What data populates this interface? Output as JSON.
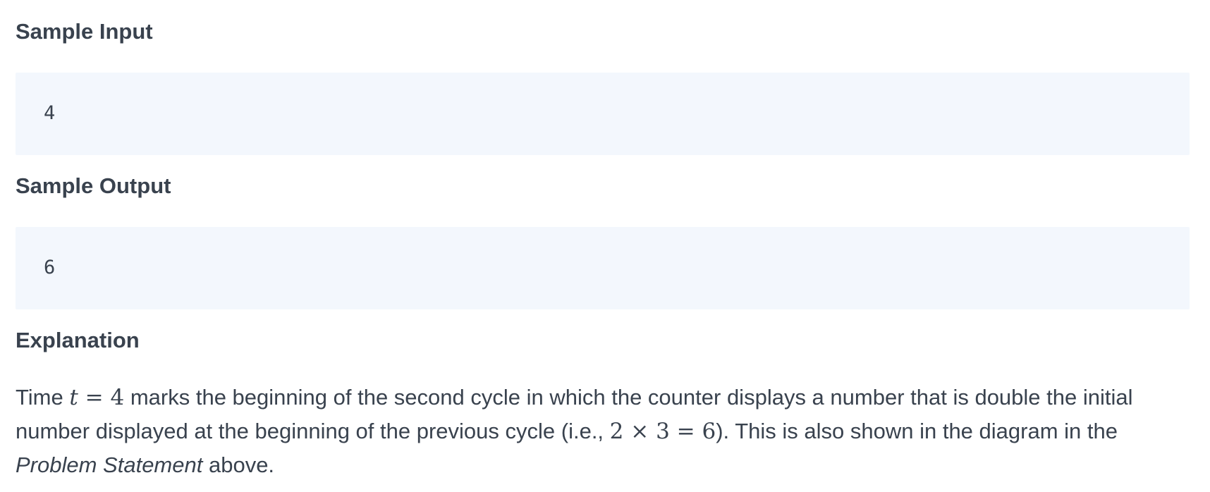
{
  "sample_input": {
    "heading": "Sample Input",
    "value": "4"
  },
  "sample_output": {
    "heading": "Sample Output",
    "value": "6"
  },
  "explanation": {
    "heading": "Explanation",
    "text_1": "Time ",
    "math_1_var": "t",
    "math_1_rest": " = 4",
    "text_2": " marks the beginning of the second cycle in which the counter displays a number that is double the initial number displayed at the beginning of the previous cycle (i.e., ",
    "math_2": "2 × 3 = 6",
    "text_3": "). This is also shown in the diagram in the ",
    "emphasis": "Problem Statement",
    "text_4": " above."
  }
}
